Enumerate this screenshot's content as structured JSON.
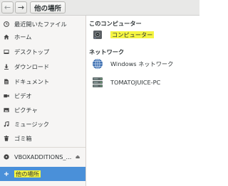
{
  "toolbar": {
    "back_icon": "chevron-left-icon",
    "forward_icon": "chevron-right-icon",
    "path": "他の場所"
  },
  "sidebar": {
    "items": [
      {
        "label": "最近開いたファイル",
        "icon": "clock-icon"
      },
      {
        "label": "ホーム",
        "icon": "home-icon"
      },
      {
        "label": "デスクトップ",
        "icon": "desktop-icon"
      },
      {
        "label": "ダウンロード",
        "icon": "download-icon"
      },
      {
        "label": "ドキュメント",
        "icon": "document-icon"
      },
      {
        "label": "ビデオ",
        "icon": "video-icon"
      },
      {
        "label": "ピクチャ",
        "icon": "picture-icon"
      },
      {
        "label": "ミュージック",
        "icon": "music-icon"
      },
      {
        "label": "ゴミ箱",
        "icon": "trash-icon"
      }
    ],
    "device": {
      "label": "VBOXADDITIONS_...",
      "icon": "disc-icon",
      "eject_icon": "eject-icon"
    },
    "other_locations": {
      "label": "他の場所",
      "icon": "plus-icon",
      "selected": true
    }
  },
  "main": {
    "this_computer": {
      "header": "このコンピューター",
      "items": [
        {
          "label": "コンピューター",
          "icon": "drive-icon",
          "highlighted": true
        }
      ]
    },
    "network": {
      "header": "ネットワーク",
      "items": [
        {
          "label": "Windows ネットワーク",
          "icon": "network-globe-icon"
        },
        {
          "label": "TOMATOJUICE-PC",
          "icon": "server-icon"
        }
      ]
    }
  },
  "colors": {
    "selection": "#4a90d9",
    "highlight": "#f5f542",
    "sidebar_bg": "#f6f5f4",
    "toolbar_bg": "#e8e8e7"
  }
}
